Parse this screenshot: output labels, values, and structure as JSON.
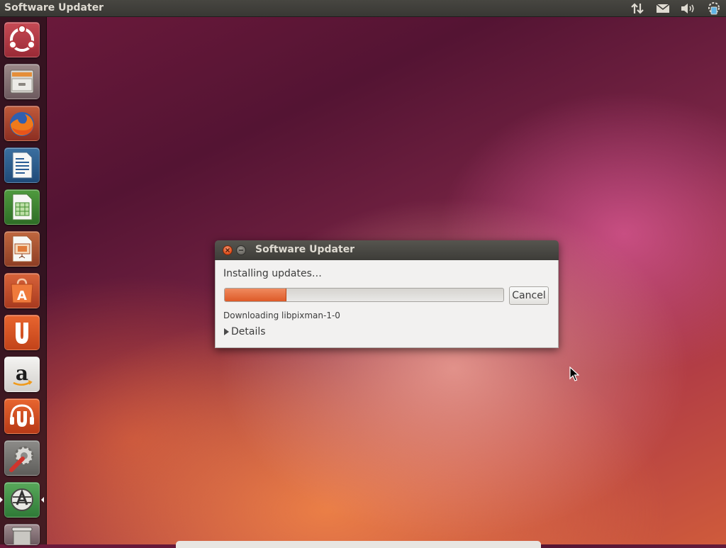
{
  "top_panel": {
    "title": "Software Updater",
    "indicators": [
      {
        "icon": "network-transfer-icon"
      },
      {
        "icon": "envelope-icon"
      },
      {
        "icon": "speaker-volume-icon"
      },
      {
        "icon": "update-notifier-icon"
      }
    ]
  },
  "launcher": {
    "items": [
      {
        "name": "dash-home",
        "icon": "ubuntu-logo-icon"
      },
      {
        "name": "files",
        "icon": "file-cabinet-icon"
      },
      {
        "name": "firefox",
        "icon": "firefox-icon"
      },
      {
        "name": "libreoffice-writer",
        "icon": "writer-document-icon"
      },
      {
        "name": "libreoffice-calc",
        "icon": "calc-spreadsheet-icon"
      },
      {
        "name": "libreoffice-impress",
        "icon": "impress-presentation-icon"
      },
      {
        "name": "ubuntu-software-center",
        "icon": "software-center-bag-icon"
      },
      {
        "name": "ubuntu-one",
        "icon": "ubuntu-one-icon"
      },
      {
        "name": "amazon",
        "icon": "amazon-icon"
      },
      {
        "name": "ubuntu-one-music",
        "icon": "ubuntu-one-music-icon"
      },
      {
        "name": "system-settings",
        "icon": "settings-wrench-gear-icon"
      },
      {
        "name": "software-updater",
        "icon": "software-updater-icon",
        "active": true
      },
      {
        "name": "trash",
        "icon": "trash-icon"
      }
    ]
  },
  "dialog": {
    "title": "Software Updater",
    "heading": "Installing updates…",
    "progress_fraction": 0.22,
    "cancel_label": "Cancel",
    "status_text": "Downloading libpixman-1-0",
    "details_label": "Details"
  },
  "colors": {
    "accent": "#dd4814",
    "panel": "#3c3b37",
    "dialog_bg": "#f2f1f0"
  }
}
